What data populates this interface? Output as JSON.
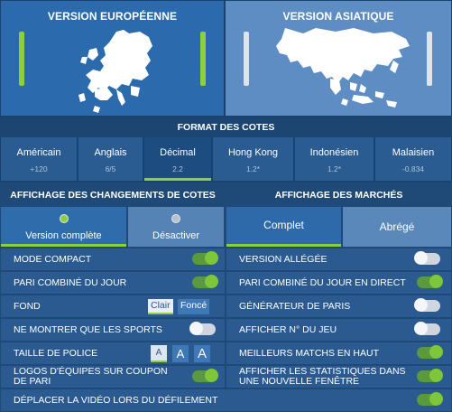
{
  "versions": {
    "european": {
      "title": "VERSION EUROPÉENNE",
      "selected": true
    },
    "asian": {
      "title": "VERSION ASIATIQUE",
      "selected": false
    }
  },
  "odds_format": {
    "heading": "FORMAT DES COTES",
    "options": [
      {
        "name": "Américain",
        "example": "+120"
      },
      {
        "name": "Anglais",
        "example": "6/5"
      },
      {
        "name": "Décimal",
        "example": "2.2",
        "selected": true
      },
      {
        "name": "Hong Kong",
        "example": "1.2*"
      },
      {
        "name": "Indonésien",
        "example": "1.2*"
      },
      {
        "name": "Malaisien",
        "example": "-0.834"
      }
    ]
  },
  "odds_changes": {
    "heading": "AFFICHAGE DES CHANGEMENTS DE COTES",
    "full_label": "Version complète",
    "disable_label": "Désactiver",
    "selected": "full"
  },
  "markets": {
    "heading": "AFFICHAGE DES MARCHÉS",
    "complete_label": "Complet",
    "short_label": "Abrégé",
    "selected": "complete"
  },
  "settings_left": {
    "compact": {
      "label": "MODE COMPACT",
      "on": true
    },
    "accum": {
      "label": "PARI COMBINÉ DU JOUR",
      "on": true
    },
    "background": {
      "label": "FOND",
      "light": "Clair",
      "dark": "Foncé",
      "selected": "light"
    },
    "sports_only": {
      "label": "NE MONTRER QUE LES SPORTS",
      "on": false
    },
    "font_size": {
      "label": "TAILLE DE POLICE",
      "sizes": [
        "A",
        "A",
        "A"
      ],
      "selected_index": 0
    },
    "team_logos": {
      "label": "LOGOS D'ÉQUIPES SUR COUPON DE PARI",
      "on": true
    },
    "move_video": {
      "label": "DÉPLACER LA VIDÉO LORS DU DÉFILEMENT",
      "on": true
    }
  },
  "settings_right": {
    "light_version": {
      "label": "VERSION ALLÉGÉE",
      "on": false
    },
    "live_accum": {
      "label": "PARI COMBINÉ DU JOUR EN DIRECT",
      "on": true
    },
    "bet_generator": {
      "label": "GÉNÉRATEUR DE PARIS",
      "on": false
    },
    "game_number": {
      "label": "AFFICHER N° DU JEU",
      "on": false
    },
    "top_matches": {
      "label": "MEILLEURS MATCHS EN HAUT",
      "on": true
    },
    "stats_window": {
      "label": "AFFICHER LES STATISTIQUES DANS UNE NOUVELLE FENÊTRE",
      "on": true
    }
  },
  "colors": {
    "accent_green": "#8fcf3a",
    "panel_blue": "#2a5a90",
    "page_bg": "#1f4a78"
  }
}
